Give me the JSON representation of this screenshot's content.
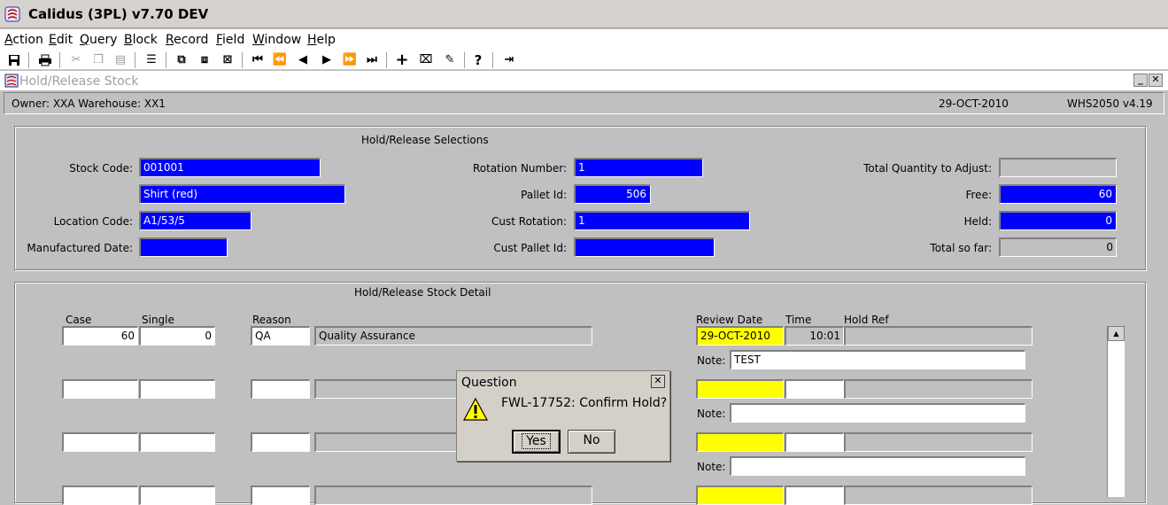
{
  "app": {
    "title": "Calidus (3PL) v7.70 DEV"
  },
  "menu": {
    "items": [
      "Action",
      "Edit",
      "Query",
      "Block",
      "Record",
      "Field",
      "Window",
      "Help"
    ]
  },
  "window": {
    "title": "Hold/Release Stock"
  },
  "info": {
    "owner": "Owner:  XXA     Warehouse:  XX1",
    "date": "29-OCT-2010",
    "module": "WHS2050  v4.19"
  },
  "selections": {
    "title": "Hold/Release Selections",
    "stock_code_label": "Stock Code:",
    "stock_code": "001001",
    "description": "Shirt (red)",
    "location_code_label": "Location Code:",
    "location_code": "A1/53/5",
    "manufactured_date_label": "Manufactured Date:",
    "manufactured_date": "",
    "rotation_number_label": "Rotation Number:",
    "rotation_number": "1",
    "pallet_id_label": "Pallet Id:",
    "pallet_id": "506",
    "cust_rotation_label": "Cust Rotation:",
    "cust_rotation": "1",
    "cust_pallet_id_label": "Cust Pallet Id:",
    "cust_pallet_id": "",
    "total_qty_label": "Total Quantity to Adjust:",
    "total_qty": "",
    "free_label": "Free:",
    "free": "60",
    "held_label": "Held:",
    "held": "0",
    "total_so_far_label": "Total so far:",
    "total_so_far": "0"
  },
  "detail": {
    "title": "Hold/Release Stock Detail",
    "headers": {
      "case": "Case",
      "single": "Single",
      "reason": "Reason",
      "review_date": "Review Date",
      "time": "Time",
      "hold_ref": "Hold Ref"
    },
    "note_label": "Note:",
    "rows": [
      {
        "case": "60",
        "single": "0",
        "reason": "QA",
        "reason_desc": "Quality Assurance",
        "review_date": "29-OCT-2010",
        "time": "10:01",
        "hold_ref": "",
        "note": "TEST"
      },
      {
        "case": "",
        "single": "",
        "reason": "",
        "reason_desc": "",
        "review_date": "",
        "time": "",
        "hold_ref": "",
        "note": ""
      },
      {
        "case": "",
        "single": "",
        "reason": "",
        "reason_desc": "",
        "review_date": "",
        "time": "",
        "hold_ref": "",
        "note": ""
      },
      {
        "case": "",
        "single": "",
        "reason": "",
        "reason_desc": "",
        "review_date": "",
        "time": "",
        "hold_ref": ""
      }
    ]
  },
  "dialog": {
    "title": "Question",
    "message": "FWL-17752:  Confirm Hold?",
    "yes_label": "Yes",
    "no_label": "No"
  },
  "colors": {
    "field_blue": "#0000ff",
    "field_yellow": "#ffff00",
    "background": "#c0c0c0"
  }
}
